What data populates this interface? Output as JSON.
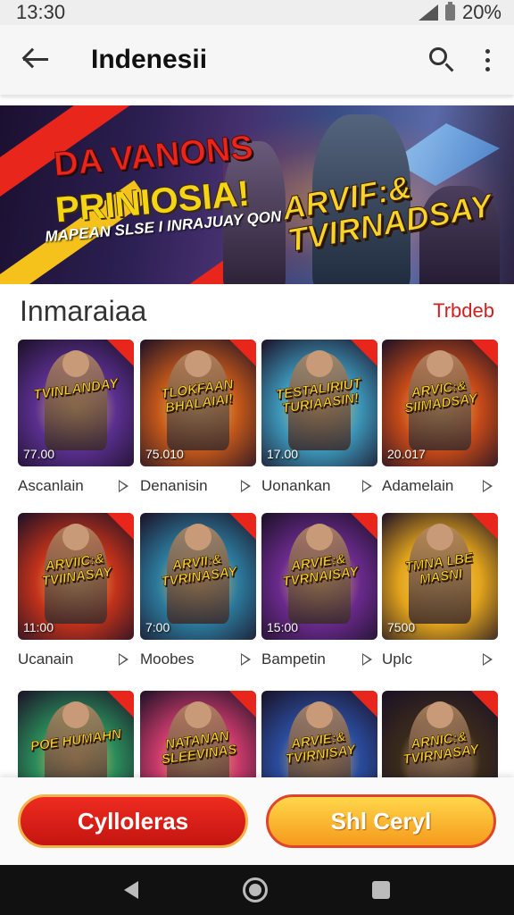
{
  "status_bar": {
    "time": "13:30",
    "battery": "20%"
  },
  "app_bar": {
    "title": "Indenesii"
  },
  "banner": {
    "headline1": "DA VANONS",
    "headline2": "PRINIOSIA!",
    "subtitle": "MAPEAN SLSE I INRAJUAY QON",
    "logo_line1": "ARVIF:&",
    "logo_line2": "TVIRNADSAY"
  },
  "section": {
    "title": "Inmaraiaa",
    "link": "Trbdeb"
  },
  "games": [
    {
      "logo": "TVINLANDAY",
      "time": "77.00",
      "label": "Ascanlain",
      "bg": "#5a2f8f"
    },
    {
      "logo": "TLOKFAAN BHALAIAI!",
      "time": "75.010",
      "label": "Denanisin",
      "bg": "#c2571a"
    },
    {
      "logo": "TESTALIRIUT TURIAASIN!",
      "time": "17.00",
      "label": "Uonankan",
      "bg": "#3c95b8"
    },
    {
      "logo": "ARVIC:& SIIMADSAY",
      "time": "20.017",
      "label": "Adamelain",
      "bg": "#c64a18"
    },
    {
      "logo": "ARVIIC:& TVIINASAY",
      "time": "11:00",
      "label": "Ucanain",
      "bg": "#c2321a"
    },
    {
      "logo": "ARVII:& TVRINASAY",
      "time": "7:00",
      "label": "Moobes",
      "bg": "#2c7a9c"
    },
    {
      "logo": "ARVIE:& TVRNAISAY",
      "time": "15:00",
      "label": "Bampetin",
      "bg": "#6a2a8c"
    },
    {
      "logo": "TMNA LBE MASNI",
      "time": "7500",
      "label": "Uplc",
      "bg": "#e2a41c"
    },
    {
      "logo": "POE HUMAHN",
      "time": "",
      "label": "",
      "bg": "#2a8a5a"
    },
    {
      "logo": "NATANAN SLEEVINAS",
      "time": "",
      "label": "",
      "bg": "#c83a6a"
    },
    {
      "logo": "ARVIE:& TVIRNISAY",
      "time": "",
      "label": "",
      "bg": "#2a4c9c"
    },
    {
      "logo": "ARNIC:& TVIRNASAY",
      "time": "",
      "label": "",
      "bg": "#3a2a1c"
    }
  ],
  "actions": {
    "primary": "Cylloleras",
    "secondary": "Shl Ceryl"
  },
  "colors": {
    "accent_red": "#e8261b",
    "accent_yellow": "#f5c21c",
    "link_red": "#d21f1f"
  },
  "icons": [
    "back-arrow-icon",
    "search-icon",
    "more-vertical-icon",
    "play-icon",
    "nav-back-icon",
    "nav-home-icon",
    "nav-recents-icon"
  ]
}
